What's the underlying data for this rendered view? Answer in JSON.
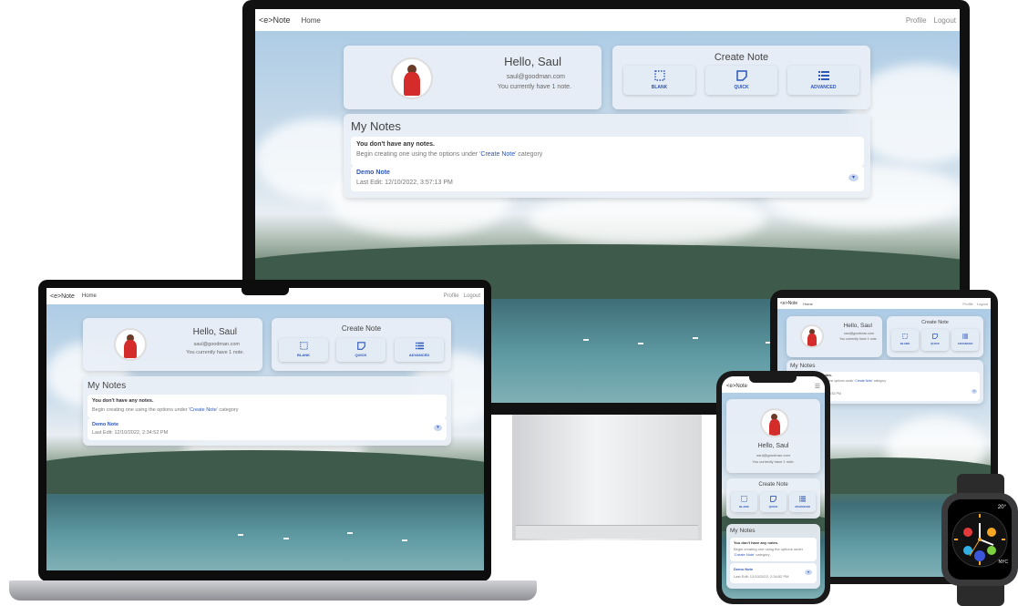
{
  "app": {
    "brand": "<e>Note",
    "nav_home": "Home",
    "nav_profile": "Profile",
    "nav_logout": "Logout"
  },
  "profile": {
    "greeting": "Hello, Saul",
    "email": "saul@goodman.com",
    "note_count_text": "You currently have 1 note."
  },
  "create": {
    "title": "Create Note",
    "buttons": [
      {
        "label": "BLANK",
        "icon": "blank-note-icon"
      },
      {
        "label": "QUICK",
        "icon": "quick-note-icon"
      },
      {
        "label": "ADVANCED",
        "icon": "list-icon"
      }
    ]
  },
  "notes": {
    "title": "My Notes",
    "empty_heading": "You don't have any notes.",
    "empty_text_pre": "Begin creating one using the options under '",
    "empty_text_link": "Create Note",
    "empty_text_post": "' category",
    "empty_text_phone_pre": "Begin creating one using the options under '",
    "items": [
      {
        "title": "Demo Note",
        "last_edit_monitor": "Last Edit: 12/10/2022, 3:57:13 PM",
        "last_edit_laptop": "Last Edit: 12/10/2022, 2:34:52 PM",
        "last_edit_phone": "Last Edit: 12/10/2022, 2:34:52 PM"
      }
    ]
  },
  "watch": {
    "digits_top": "20°",
    "right_label": "NYC"
  },
  "colors": {
    "accent": "#2d57b8",
    "card_bg": "#e9eff6",
    "navbar_bg": "#ffffff"
  }
}
